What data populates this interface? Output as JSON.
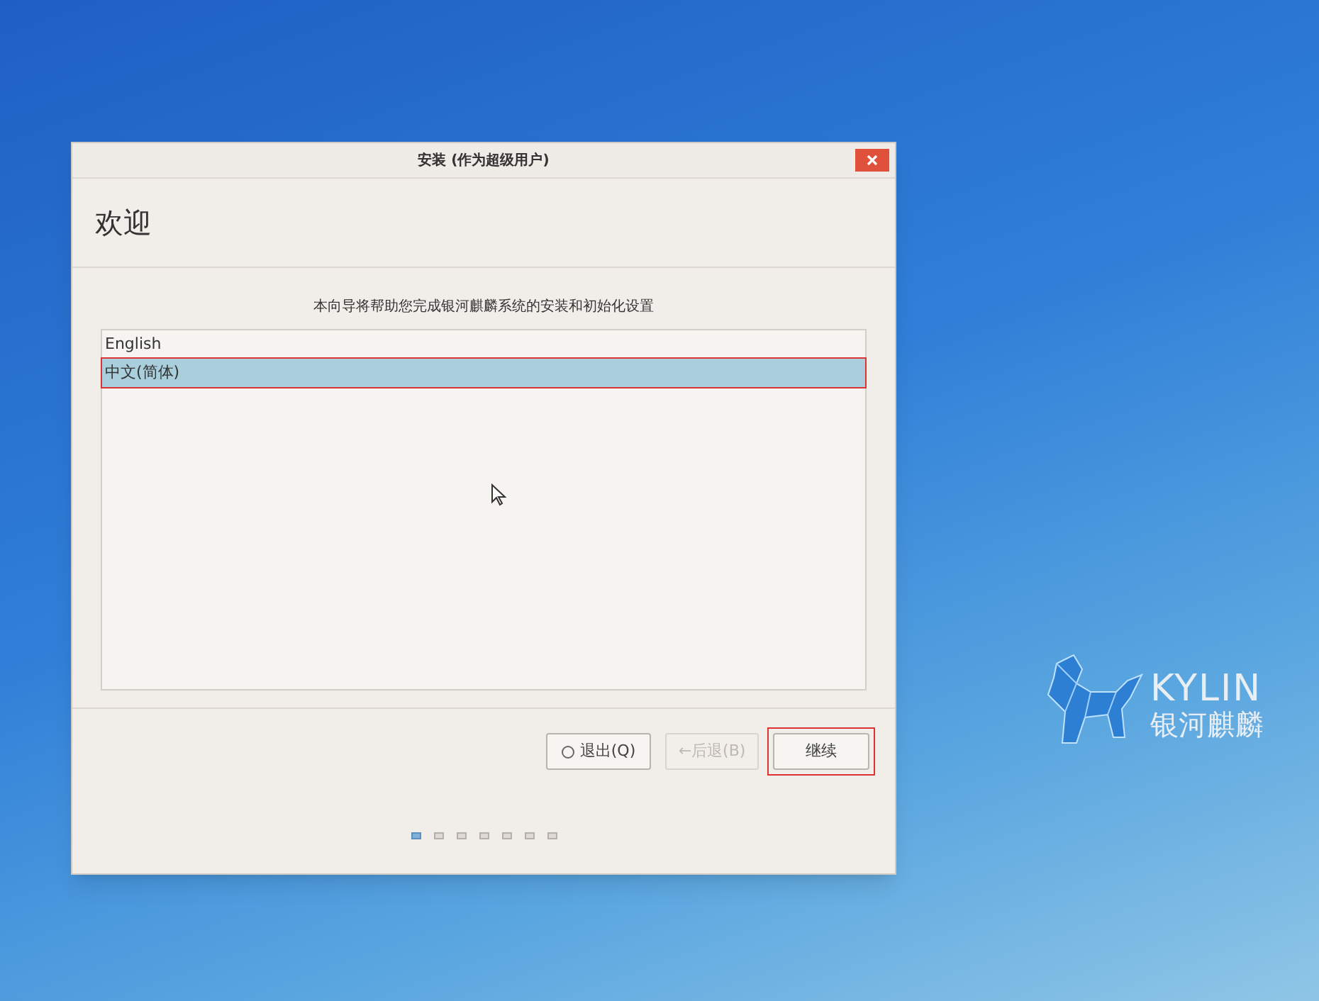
{
  "window": {
    "title": "安装 (作为超级用户)"
  },
  "heading": "欢迎",
  "intro": "本向导将帮助您完成银河麒麟系统的安装和初始化设置",
  "languages": [
    {
      "label": "English",
      "selected": false,
      "annotated": false
    },
    {
      "label": "中文(简体)",
      "selected": true,
      "annotated": true
    }
  ],
  "buttons": [
    {
      "kind": "quit",
      "label": "退出(Q)",
      "disabled": false,
      "annotated": false
    },
    {
      "kind": "back",
      "label": "←后退(B)",
      "disabled": true,
      "annotated": false
    },
    {
      "kind": "next",
      "label": "继续",
      "disabled": false,
      "annotated": true
    }
  ],
  "steps": [
    {
      "selected": true
    },
    {
      "selected": false
    },
    {
      "selected": false
    },
    {
      "selected": false
    },
    {
      "selected": false
    },
    {
      "selected": false
    },
    {
      "selected": false
    }
  ],
  "logo": {
    "name": "KYLIN",
    "subtitle": "银河麒麟"
  }
}
